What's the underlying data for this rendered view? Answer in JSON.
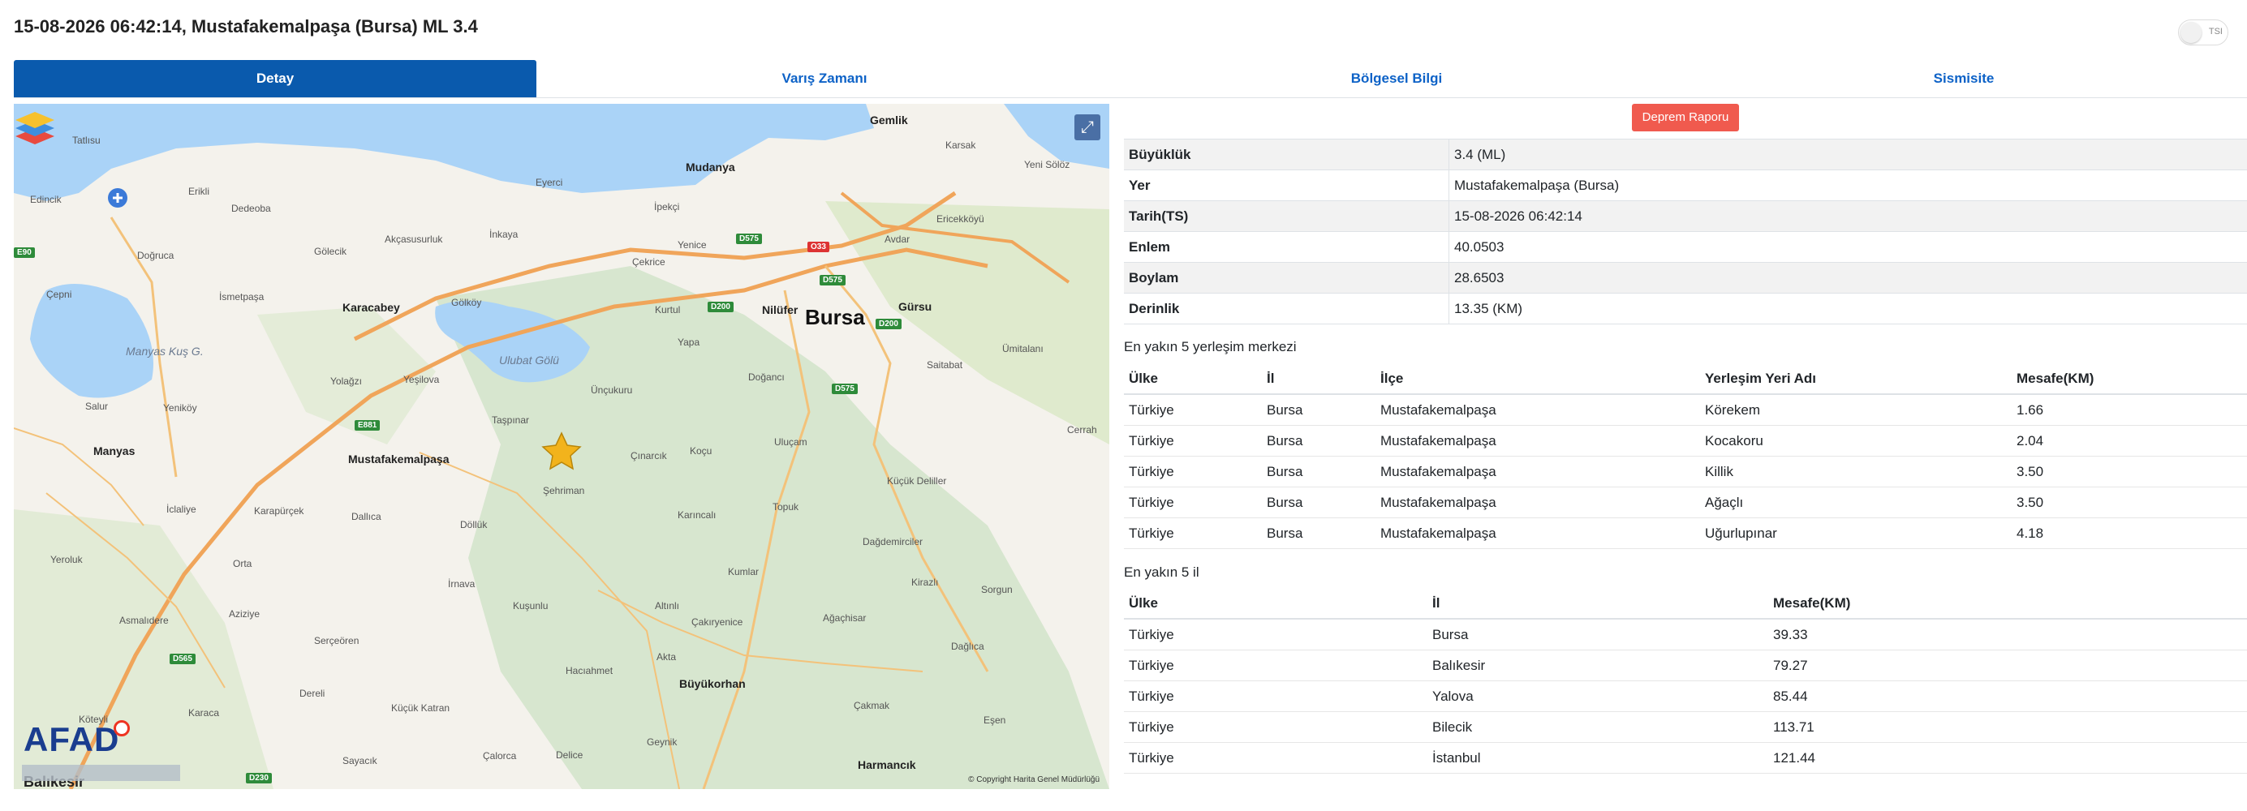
{
  "title": "15-08-2026 06:42:14, Mustafakemalpaşa (Bursa) ML 3.4",
  "toggle_label": "TSI",
  "tabs": [
    "Detay",
    "Varış Zamanı",
    "Bölgesel Bilgi",
    "Sismisite"
  ],
  "report_button": "Deprem Raporu",
  "info": [
    {
      "key": "Büyüklük",
      "value": "3.4 (ML)"
    },
    {
      "key": "Yer",
      "value": "Mustafakemalpaşa (Bursa)"
    },
    {
      "key": "Tarih(TS)",
      "value": "15-08-2026 06:42:14"
    },
    {
      "key": "Enlem",
      "value": "40.0503"
    },
    {
      "key": "Boylam",
      "value": "28.6503"
    },
    {
      "key": "Derinlik",
      "value": "13.35 (KM)"
    }
  ],
  "settlements": {
    "heading": "En yakın 5 yerleşim merkezi",
    "columns": [
      "Ülke",
      "İl",
      "İlçe",
      "Yerleşim Yeri Adı",
      "Mesafe(KM)"
    ],
    "rows": [
      [
        "Türkiye",
        "Bursa",
        "Mustafakemalpaşa",
        "Körekem",
        "1.66"
      ],
      [
        "Türkiye",
        "Bursa",
        "Mustafakemalpaşa",
        "Kocakoru",
        "2.04"
      ],
      [
        "Türkiye",
        "Bursa",
        "Mustafakemalpaşa",
        "Killik",
        "3.50"
      ],
      [
        "Türkiye",
        "Bursa",
        "Mustafakemalpaşa",
        "Ağaçlı",
        "3.50"
      ],
      [
        "Türkiye",
        "Bursa",
        "Mustafakemalpaşa",
        "Uğurlupınar",
        "4.18"
      ]
    ]
  },
  "provinces": {
    "heading": "En yakın 5 il",
    "columns": [
      "Ülke",
      "İl",
      "Mesafe(KM)"
    ],
    "rows": [
      [
        "Türkiye",
        "Bursa",
        "39.33"
      ],
      [
        "Türkiye",
        "Balıkesir",
        "79.27"
      ],
      [
        "Türkiye",
        "Yalova",
        "85.44"
      ],
      [
        "Türkiye",
        "Bilecik",
        "113.71"
      ],
      [
        "Türkiye",
        "İstanbul",
        "121.44"
      ]
    ]
  },
  "map": {
    "labels": [
      "Tatlısu",
      "Gemlik",
      "Mudanya",
      "Karsak",
      "Yeni Sölöz",
      "Erikli",
      "Edincik",
      "Dedeoba",
      "Eyerci",
      "Gölecik",
      "Akçasusurluk",
      "İnkaya",
      "İpekçi",
      "Doğruca",
      "Yenice",
      "Çekrice",
      "Avdar",
      "Ericekköyü",
      "Çepni",
      "İsmetpaşa",
      "Gölköy",
      "Kurtul",
      "Nilüfer",
      "Gürsu",
      "Karacabey",
      "Bursa",
      "Manyas Kuş G.",
      "Ulubat Gölü",
      "Yapa",
      "Doğancı",
      "Saitabat",
      "Ümitalanı",
      "Yolağzı",
      "Yeşilova",
      "Ünçukuru",
      "Salur",
      "Yeniköy",
      "Taşpınar",
      "Çınarcık",
      "Koçu",
      "Uluçam",
      "Manyas",
      "Mustafakemalpaşa",
      "Şehriman",
      "Küçük Deliller",
      "Cerrah",
      "İclaliye",
      "Dallıca",
      "Karapürçek",
      "Döllük",
      "Karıncalı",
      "Topuk",
      "Dağdemirciler",
      "Yeroluk",
      "Orta",
      "İrnava",
      "Kumlar",
      "Kirazlı",
      "Sorgun",
      "Asmalıdere",
      "Aziziye",
      "Kuşunlu",
      "Altınlı",
      "Çakıryenice",
      "Ağaçhisar",
      "Serçeören",
      "Hacıahmet",
      "Akta",
      "Dağlıca",
      "Dereli",
      "Büyükorhan",
      "Köteyli",
      "Karaca",
      "Küçük Katran",
      "Geynik",
      "Çakmak",
      "Eşen",
      "Sayacık",
      "Çalorca",
      "Delice",
      "Harmancık",
      "Balıkesir"
    ],
    "shields": [
      "E90",
      "D575",
      "O33",
      "D200",
      "D575",
      "D200",
      "E881",
      "D575",
      "D565",
      "D230"
    ],
    "copyright": "© Copyright Harita Genel Müdürlüğü",
    "logo": "AFAD"
  }
}
